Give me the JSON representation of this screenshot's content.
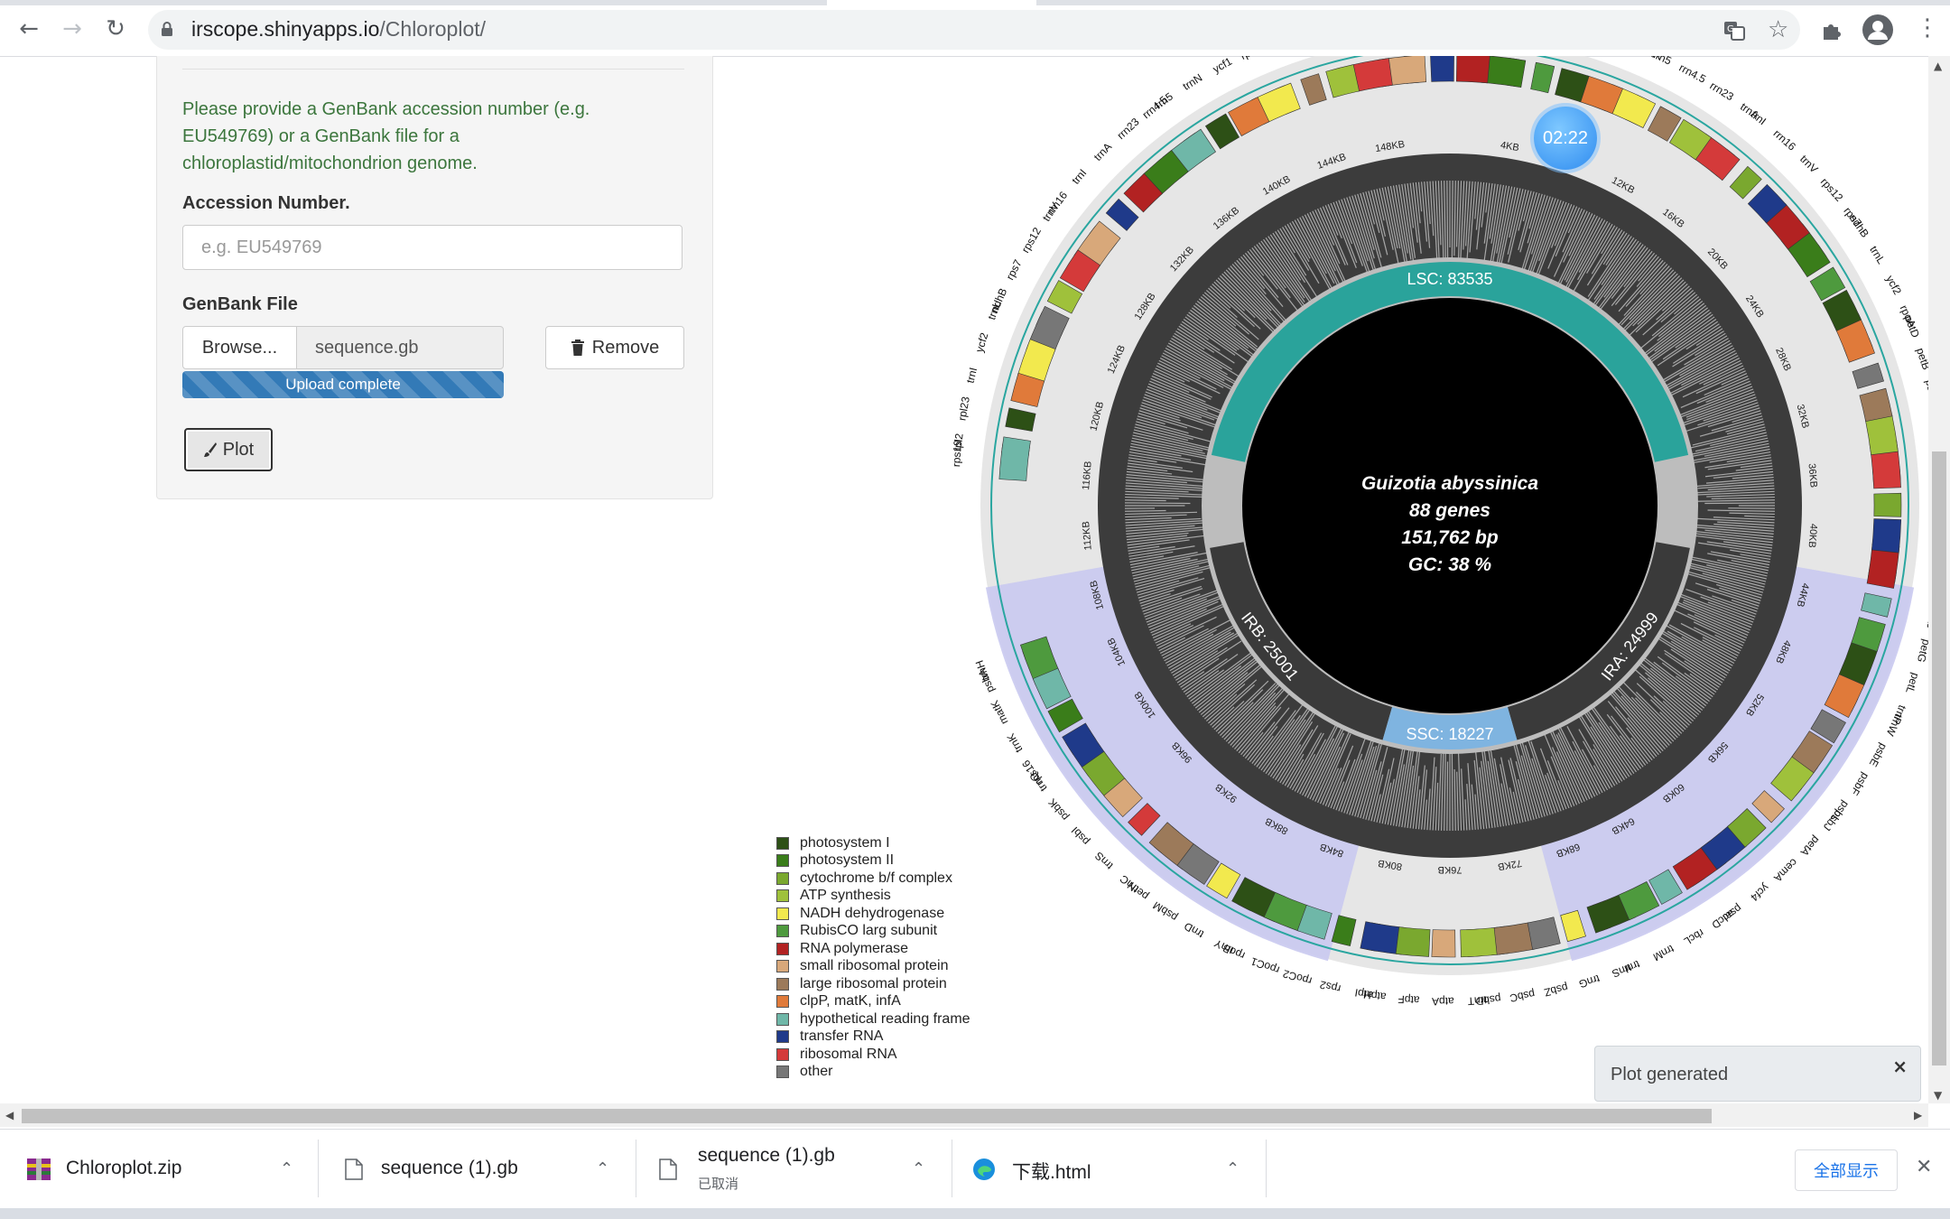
{
  "browser": {
    "url_host": "irscope.shinyapps.io",
    "url_path": "/Chloroplot/"
  },
  "form": {
    "help_text": "Please provide a GenBank accession number (e.g. EU549769) or a GenBank file for a chloroplastid/mitochondrion genome.",
    "accession_label": "Accession Number.",
    "accession_placeholder": "e.g. EU549769",
    "accession_value": "",
    "genbank_label": "GenBank File",
    "browse_label": "Browse...",
    "file_name": "sequence.gb",
    "upload_status": "Upload complete",
    "upload_progress": 1.0,
    "remove_label": "Remove",
    "plot_label": "Plot"
  },
  "timer": "02:22",
  "legend": [
    {
      "label": "photosystem I",
      "color": "#2d5016"
    },
    {
      "label": "photosystem II",
      "color": "#3a7d1a"
    },
    {
      "label": "cytochrome b/f complex",
      "color": "#7aa82f"
    },
    {
      "label": "ATP synthesis",
      "color": "#9fc13b"
    },
    {
      "label": "NADH dehydrogenase",
      "color": "#f2e94e"
    },
    {
      "label": "RubisCO larg subunit",
      "color": "#4e9a3e"
    },
    {
      "label": "RNA polymerase",
      "color": "#b22222"
    },
    {
      "label": "small ribosomal protein",
      "color": "#d8a87a"
    },
    {
      "label": "large ribosomal protein",
      "color": "#9c7a5a"
    },
    {
      "label": "clpP, matK, infA",
      "color": "#e07a3a"
    },
    {
      "label": "hypothetical reading frame",
      "color": "#6fb7a8"
    },
    {
      "label": "transfer RNA",
      "color": "#1f3a8a"
    },
    {
      "label": "ribosomal RNA",
      "color": "#d43a3a"
    },
    {
      "label": "other",
      "color": "#777777"
    }
  ],
  "genome": {
    "species": "Guizotia abyssinica",
    "genes": "88 genes",
    "length": "151,762 bp",
    "gc": "GC: 38 %",
    "regions": {
      "lsc": "LSC: 83535",
      "irb": "IRB: 25001",
      "ssc": "SSC: 18227",
      "ira": "IRA: 24999"
    },
    "kb_ticks": [
      "4KB",
      "8KB",
      "12KB",
      "16KB",
      "20KB",
      "24KB",
      "28KB",
      "32KB",
      "36KB",
      "40KB",
      "44KB",
      "48KB",
      "52KB",
      "56KB",
      "60KB",
      "64KB",
      "68KB",
      "72KB",
      "76KB",
      "80KB",
      "84KB",
      "88KB",
      "92KB",
      "96KB",
      "100KB",
      "104KB",
      "108KB",
      "112KB",
      "116KB",
      "120KB",
      "124KB",
      "128KB",
      "132KB",
      "136KB",
      "140KB",
      "144KB",
      "148KB"
    ],
    "gene_labels_outer": [
      "trnH",
      "psbA",
      "matK",
      "trnK",
      "rps16",
      "trnQ",
      "psbK",
      "psbI",
      "trnS",
      "trnC",
      "petN",
      "psbM",
      "trnD",
      "trnY",
      "rpoB",
      "rpoC1",
      "rpoC2",
      "rps2",
      "atpI",
      "atpH",
      "atpF",
      "atpA",
      "trnT",
      "psbD",
      "psbC",
      "psbZ",
      "trnG",
      "trnS",
      "trnI",
      "trnM",
      "rbcL",
      "accD",
      "psaI",
      "ycf4",
      "cemA",
      "petA",
      "psbJ",
      "psbL",
      "psbF",
      "psbE",
      "trnW",
      "trnP",
      "petL",
      "petG",
      "psaJ",
      "rpl33",
      "rps18",
      "rpl20",
      "rps12",
      "clpP",
      "psbB",
      "psbT",
      "psbH",
      "petB",
      "petD",
      "rpoA",
      "ycf2",
      "trnL",
      "ndhB",
      "rps7",
      "rps12",
      "trnV",
      "rrn16",
      "trnI",
      "trnA",
      "rrn23",
      "rrn4.5",
      "rrn5",
      "trnR",
      "trnN",
      "ycf1",
      "ndhF",
      "rpl32",
      "trnL",
      "ccsA",
      "ndhD",
      "psaC",
      "ndhE",
      "ndhG",
      "ndhI",
      "ndhA",
      "ndhH",
      "rps15",
      "ycf1",
      "trnN",
      "rrn5",
      "rrn4.5",
      "rrn23",
      "trnA",
      "trnI",
      "rrn16",
      "trnV",
      "rps12",
      "rps7",
      "ndhB",
      "trnL",
      "ycf2",
      "trnI",
      "rpl23",
      "rpl2",
      "rps19"
    ]
  },
  "notification": {
    "text": "Plot generated",
    "close": "×"
  },
  "downloads": [
    {
      "name": "Chloroplot.zip",
      "sub": ""
    },
    {
      "name": "sequence (1).gb",
      "sub": ""
    },
    {
      "name": "sequence (1).gb",
      "sub": "已取消"
    },
    {
      "name": "下载.html",
      "sub": ""
    }
  ],
  "download_bar": {
    "show_all": "全部显示",
    "close": "✕"
  }
}
